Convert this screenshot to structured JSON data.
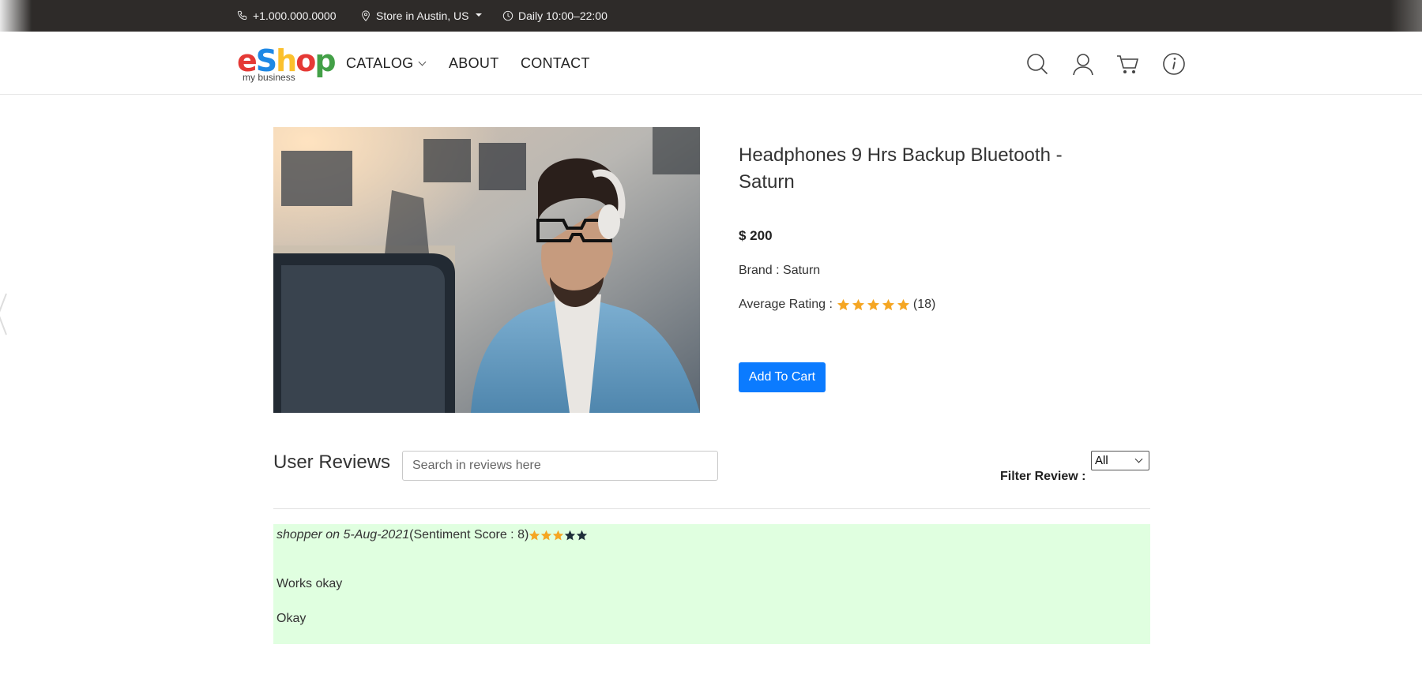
{
  "topbar": {
    "phone": "+1.000.000.0000",
    "store": "Store in Austin, US",
    "hours": "Daily 10:00–22:00"
  },
  "logo": {
    "letters": [
      "e",
      "S",
      "h",
      "o",
      "p"
    ],
    "colors": [
      "#e53935",
      "#1e88e5",
      "#fbc02d",
      "#e53935",
      "#43a047"
    ],
    "tagline": "my business"
  },
  "nav": {
    "catalog": "CATALOG",
    "about": "ABOUT",
    "contact": "CONTACT"
  },
  "icons": [
    "search-icon",
    "user-icon",
    "cart-icon",
    "info-icon"
  ],
  "product": {
    "title": "Headphones 9 Hrs Backup Bluetooth - Saturn",
    "price": "$ 200",
    "brand": "Brand : Saturn",
    "rating_label": "Average Rating :",
    "rating_value": 5,
    "rating_count": "(18)",
    "add_to_cart": "Add To Cart"
  },
  "reviews": {
    "heading": "User Reviews",
    "search_placeholder": "Search in reviews here",
    "filter_label": "Filter Review :",
    "filter_selected": "All",
    "items": [
      {
        "author_date": "shopper on 5-Aug-2021",
        "sentiment": "(Sentiment Score : 8)",
        "stars_filled": 3,
        "stars_total": 5,
        "title": "Works okay",
        "body": "Okay"
      }
    ]
  },
  "colors": {
    "accent": "#0b7bff",
    "star": "#f5a623",
    "star_empty": "#1f2f3a",
    "review_bg": "#e0ffe0",
    "topbar_bg": "#2e2b29"
  }
}
